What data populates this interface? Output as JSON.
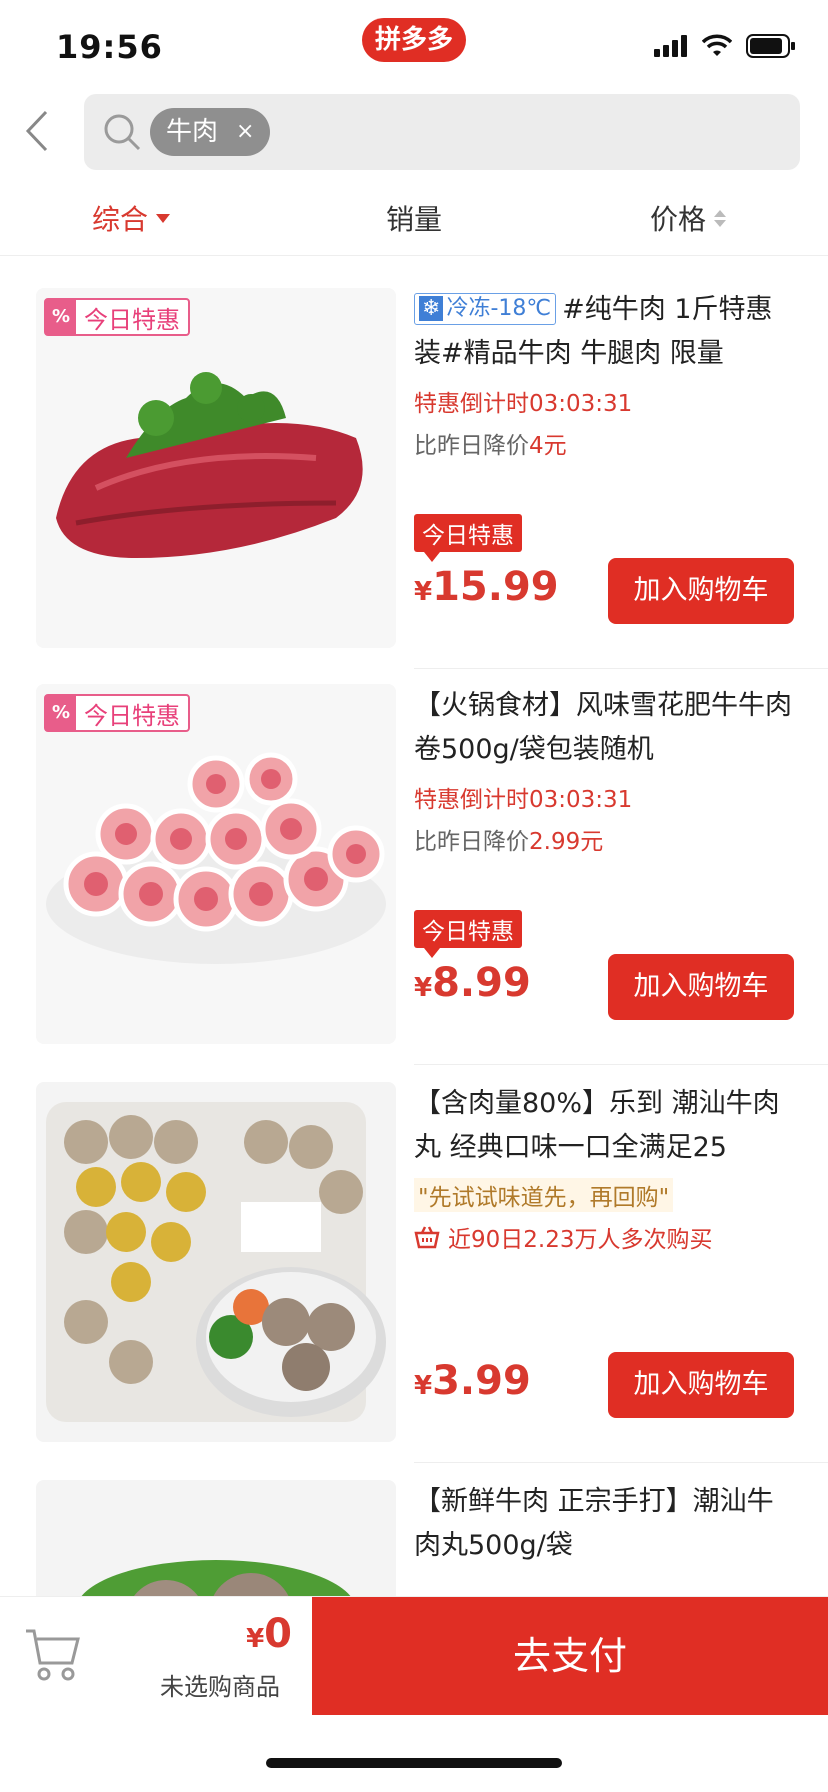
{
  "status_bar": {
    "time": "19:56",
    "app_name": "拼多多"
  },
  "search": {
    "chip_label": "牛肉",
    "chip_close": "×"
  },
  "sort_tabs": [
    {
      "label": "综合"
    },
    {
      "label": "销量"
    },
    {
      "label": "价格"
    }
  ],
  "products": [
    {
      "deal_tag": "今日特惠",
      "frozen_label": "冷冻-18℃",
      "title": "#纯牛肉 1斤特惠装#精品牛肉 牛腿肉 限量",
      "countdown": "特惠倒计时03:03:31",
      "drop_prefix": "比昨日降价",
      "drop_amount": "4元",
      "today_badge": "今日特惠",
      "currency": "¥",
      "price": "15.99",
      "add_cart": "加入购物车"
    },
    {
      "deal_tag": "今日特惠",
      "title": "【火锅食材】风味雪花肥牛牛肉卷500g/袋包装随机",
      "countdown": "特惠倒计时03:03:31",
      "drop_prefix": "比昨日降价",
      "drop_amount": "2.99元",
      "today_badge": "今日特惠",
      "currency": "¥",
      "price": "8.99",
      "add_cart": "加入购物车"
    },
    {
      "title": "【含肉量80%】乐到 潮汕牛肉丸 经典口味一口全满足25",
      "quote": "\"先试试味道先，再回购\"",
      "buyers": "近90日2.23万人多次购买",
      "currency": "¥",
      "price": "3.99",
      "add_cart": "加入购物车"
    },
    {
      "title": "【新鲜牛肉 正宗手打】潮汕牛肉丸500g/袋"
    }
  ],
  "bottom_bar": {
    "currency": "¥",
    "total": "0",
    "unselected": "未选购商品",
    "pay_label": "去支付"
  },
  "colors": {
    "accent": "#e02e24",
    "deal_pink": "#e85d8a",
    "frozen_blue": "#3f7fd6"
  },
  "icons": [
    "back-arrow-icon",
    "search-icon",
    "cart-icon",
    "signal-icon",
    "wifi-icon",
    "battery-icon",
    "basket-icon"
  ]
}
